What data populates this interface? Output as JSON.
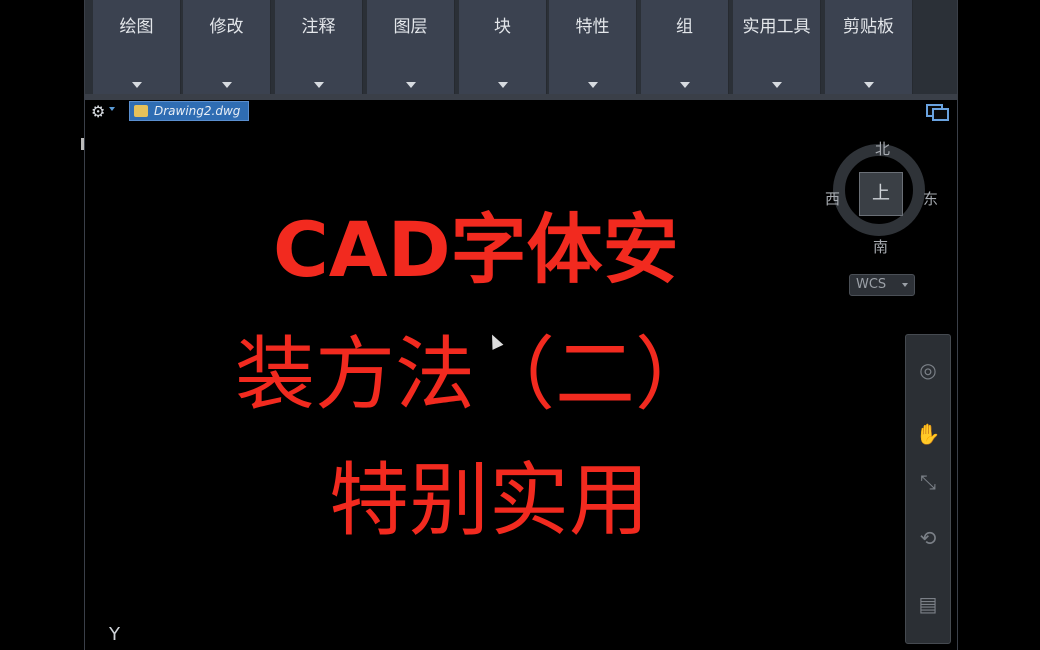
{
  "ribbon": {
    "panels": [
      {
        "label": "绘图"
      },
      {
        "label": "修改"
      },
      {
        "label": "注释"
      },
      {
        "label": "图层"
      },
      {
        "label": "块"
      },
      {
        "label": "特性"
      },
      {
        "label": "组"
      },
      {
        "label": "实用工具"
      },
      {
        "label": "剪贴板"
      }
    ]
  },
  "file_tab": {
    "name": "Drawing2.dwg"
  },
  "viewcube": {
    "north": "北",
    "south": "南",
    "east": "东",
    "west": "西",
    "face": "上"
  },
  "wcs": {
    "label": "WCS"
  },
  "title": {
    "line1": "CAD字体安",
    "line2": "装方法（二）",
    "line3": "特别实用"
  },
  "ucs": {
    "y_label": "Y"
  },
  "colors": {
    "title_red": "#f22a1f",
    "ribbon_bg": "#3b4250",
    "tab_blue": "#2f6db3"
  }
}
